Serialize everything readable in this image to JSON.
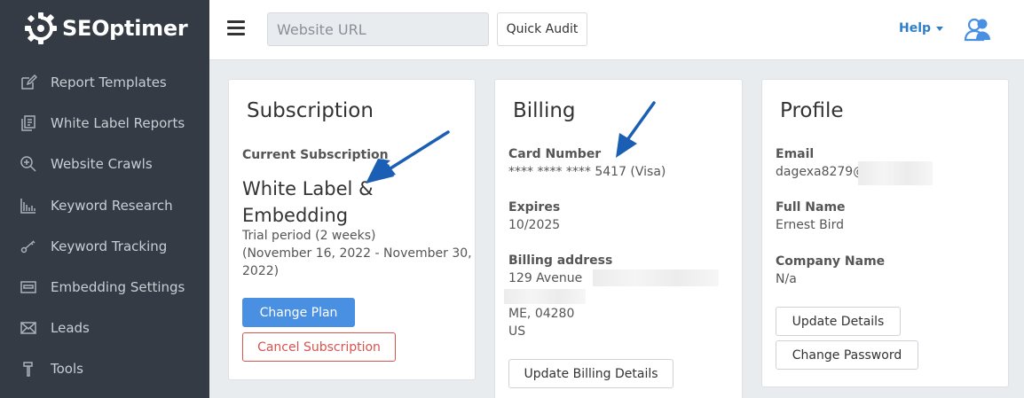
{
  "app": {
    "logo_text": "SEOptimer"
  },
  "sidebar": {
    "items": [
      {
        "label": "Report Templates",
        "icon": "edit-icon"
      },
      {
        "label": "White Label Reports",
        "icon": "copy-icon"
      },
      {
        "label": "Website Crawls",
        "icon": "zoom-icon"
      },
      {
        "label": "Keyword Research",
        "icon": "bar-chart-icon"
      },
      {
        "label": "Keyword Tracking",
        "icon": "key-icon"
      },
      {
        "label": "Embedding Settings",
        "icon": "embed-icon"
      },
      {
        "label": "Leads",
        "icon": "mail-icon"
      },
      {
        "label": "Tools",
        "icon": "hammer-icon"
      }
    ]
  },
  "topbar": {
    "url_placeholder": "Website URL",
    "quick_audit_label": "Quick Audit",
    "help_label": "Help"
  },
  "subscription": {
    "title": "Subscription",
    "current_label": "Current Subscription",
    "plan_line1": "White Label &",
    "plan_line2": "Embedding",
    "trial_line1": "Trial period (2 weeks)",
    "trial_line2": "(November 16, 2022 - November 30,",
    "trial_line3": "2022)",
    "change_plan_label": "Change Plan",
    "cancel_label": "Cancel Subscription"
  },
  "billing": {
    "title": "Billing",
    "card_label": "Card Number",
    "card_value": "**** **** **** 5417 (Visa)",
    "expires_label": "Expires",
    "expires_value": "10/2025",
    "address_label": "Billing address",
    "address_line1": "129 Avenue",
    "address_line3": "ME, 04280",
    "address_line4": "US",
    "update_label": "Update Billing Details"
  },
  "profile": {
    "title": "Profile",
    "email_label": "Email",
    "email_value": "dagexa8279@",
    "name_label": "Full Name",
    "name_value": "Ernest Bird",
    "company_label": "Company Name",
    "company_value": "N/a",
    "update_details_label": "Update Details",
    "change_password_label": "Change Password"
  },
  "colors": {
    "sidebar_bg": "#343b44",
    "accent_blue": "#4a90e2",
    "help_blue": "#2f7fc8",
    "danger_red": "#d9534f"
  }
}
